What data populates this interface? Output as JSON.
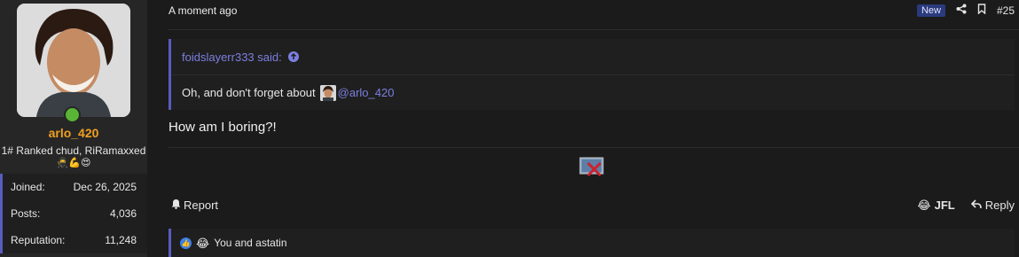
{
  "user": {
    "name": "arlo_420",
    "title": "1# Ranked chud, RiRamaxxed",
    "banners": "🥷💪😍",
    "stats": [
      {
        "label": "Joined:",
        "value": "Dec 26, 2025"
      },
      {
        "label": "Posts:",
        "value": "4,036"
      },
      {
        "label": "Reputation:",
        "value": "11,248"
      }
    ]
  },
  "post": {
    "time": "A moment ago",
    "badge": "New",
    "number": "#25",
    "quote": {
      "author": "foidslayerr333 said:",
      "text": "Oh, and don't forget about",
      "mention": "@arlo_420"
    },
    "message": "How am I boring?!",
    "actions": {
      "report": "Report",
      "jfl": "JFL",
      "reply": "Reply"
    },
    "reactions_text": "You and astatin"
  },
  "colors": {
    "accent": "#5a5bbf",
    "link": "#7c7fe0",
    "username": "#f0a020",
    "online": "#58b535"
  },
  "icons": [
    "share-icon",
    "bookmark-icon",
    "arrow-up-icon",
    "bell-icon",
    "reply-icon",
    "like-icon",
    "laugh-icon",
    "broken-image-icon"
  ]
}
